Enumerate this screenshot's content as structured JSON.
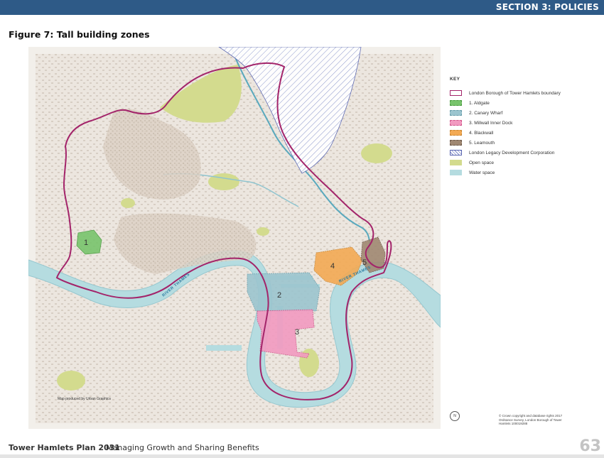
{
  "header": {
    "section_title": "SECTION 3: POLICIES",
    "bar_color": "#2e5a87"
  },
  "figure": {
    "title": "Figure 7: Tall building zones"
  },
  "map": {
    "zone_labels": [
      "1",
      "2",
      "3",
      "4",
      "5"
    ],
    "river_label": "RIVER THAMES",
    "credit": "Map produced by Urban Graphics",
    "copyright": "© Crown copyright and database rights 2017 Ordnance Survey, London Borough of Tower Hamlets 100019288",
    "north_label": "N"
  },
  "key": {
    "heading": "KEY",
    "items": [
      {
        "label": "London Borough of Tower Hamlets boundary",
        "color": "#a3246a"
      },
      {
        "label": "1. Aldgate",
        "color": "#78c46c"
      },
      {
        "label": "2. Canary Wharf",
        "color": "#9cc5cf"
      },
      {
        "label": "3. Millwall Inner Dock",
        "color": "#f29ac0"
      },
      {
        "label": "4. Blackwall",
        "color": "#f3aa54"
      },
      {
        "label": "5. Leamouth",
        "color": "#a08872"
      },
      {
        "label": "London Legacy Development Corporation",
        "color": "#8a8ad6"
      },
      {
        "label": "Open space",
        "color": "#d3db8e"
      },
      {
        "label": "Water space",
        "color": "#b5dce0"
      }
    ]
  },
  "footer": {
    "document_title": "Tower Hamlets Plan 2031",
    "document_subtitle": "Managing Growth and Sharing Benefits",
    "page_number": "63"
  }
}
